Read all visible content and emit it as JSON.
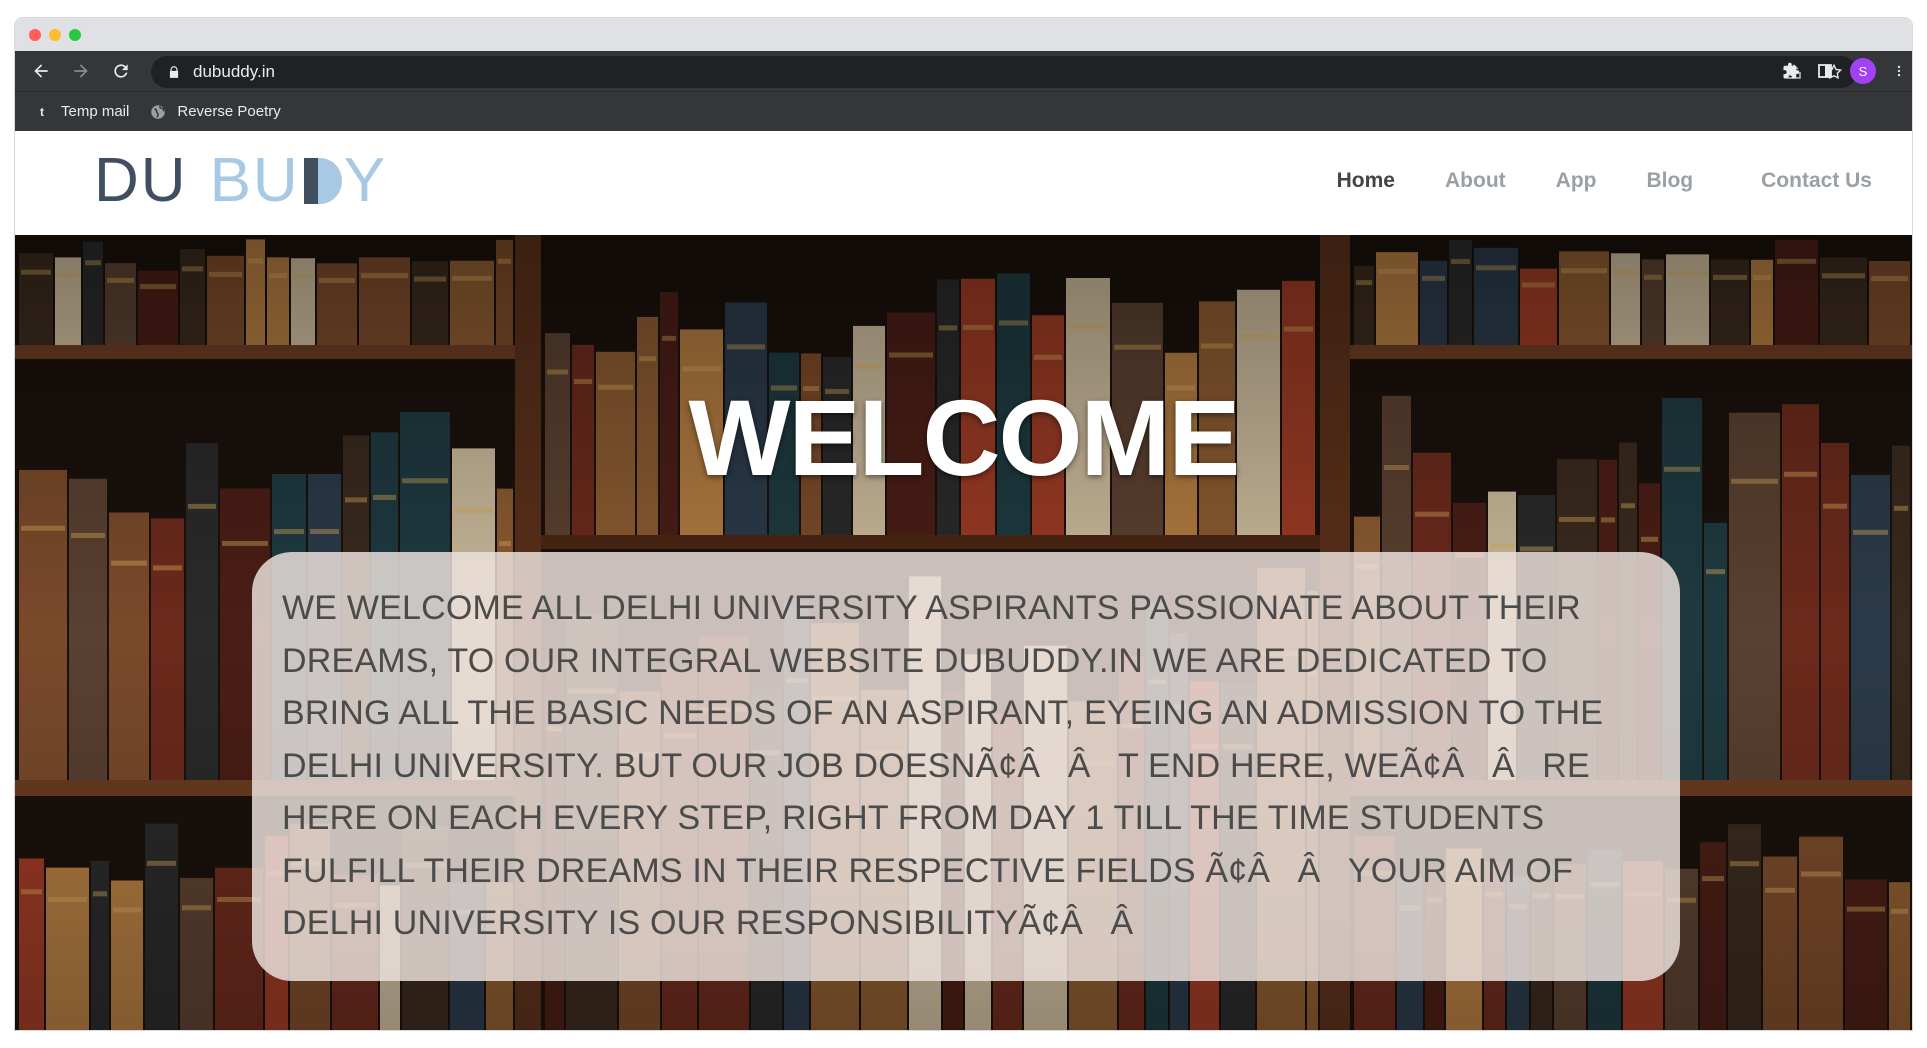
{
  "browser": {
    "url": "dubuddy.in",
    "bookmarks": [
      {
        "label": "Temp mail",
        "icon": "t"
      },
      {
        "label": "Reverse Poetry",
        "icon": "globe-icon"
      }
    ],
    "profile_initial": "S"
  },
  "site": {
    "logo": {
      "du": "DU",
      "bu": "BU",
      "y": "Y"
    },
    "nav": [
      "Home",
      "About",
      "App",
      "Blog",
      "Contact Us"
    ],
    "active_nav": "Home",
    "hero": {
      "heading": "WELCOME",
      "body": "WE WELCOME ALL DELHI UNIVERSITY ASPIRANTS PASSIONATE ABOUT THEIR DREAMS, TO OUR INTEGRAL WEBSITE DUBUDDY.IN WE ARE DEDICATED TO BRING ALL THE BASIC NEEDS OF AN ASPIRANT, EYEING AN ADMISSION TO THE DELHI UNIVERSITY. BUT OUR JOB DOESNÃ¢ÂÂT END HERE, WEÃ¢ÂÂRE HERE ON EACH EVERY STEP, RIGHT FROM DAY 1 TILL THE TIME STUDENTS FULFILL THEIR DREAMS IN THEIR RESPECTIVE FIELDS Ã¢ÂÂYOUR AIM OF DELHI UNIVERSITY IS OUR RESPONSIBILITYÃ¢ÂÂ"
    }
  },
  "colors": {
    "toolbar": "#35363a",
    "omnibox": "#202124",
    "logo_dark": "#3f4f60",
    "logo_light": "#a8c9e4",
    "panel": "rgba(236,225,221,0.84)"
  }
}
